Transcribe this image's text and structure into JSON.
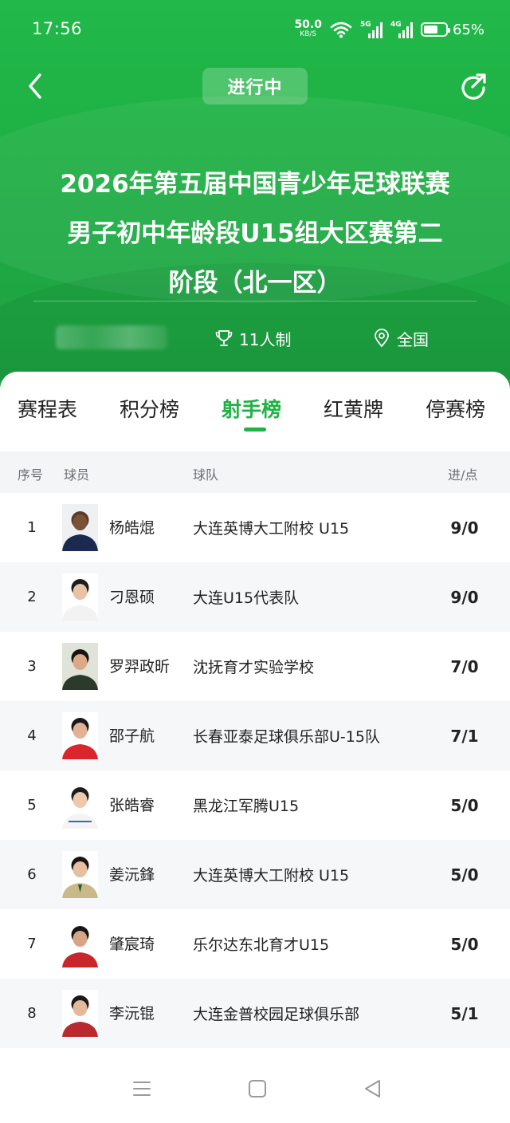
{
  "status_bar": {
    "time": "17:56",
    "net_speed_value": "50.0",
    "net_speed_unit": "KB/S",
    "sim1_label": "5G",
    "sim2_label": "4G",
    "battery_percent": "65%",
    "battery_level": 0.65
  },
  "header": {
    "status_label": "进行中",
    "title_line1": "2026年第五届中国青少年足球联赛",
    "title_line2": "男子初中年龄段U15组大区赛第二",
    "title_line3": "阶段（北一区）",
    "format_label": "11人制",
    "region_label": "全国",
    "accent_color": "#1fb245"
  },
  "tabs": [
    {
      "label": "赛程表"
    },
    {
      "label": "积分榜"
    },
    {
      "label": "射手榜"
    },
    {
      "label": "红黄牌"
    },
    {
      "label": "停赛榜"
    }
  ],
  "table": {
    "headers": {
      "rank": "序号",
      "player": "球员",
      "team": "球队",
      "goals": "进/点"
    },
    "rows": [
      {
        "rank": "1",
        "name": "杨皓焜",
        "team": "大连英博大工附校 U15",
        "goals": "9/0"
      },
      {
        "rank": "2",
        "name": "刁恩硕",
        "team": "大连U15代表队",
        "goals": "9/0"
      },
      {
        "rank": "3",
        "name": "罗羿政昕",
        "team": "沈抚育才实验学校",
        "goals": "7/0"
      },
      {
        "rank": "4",
        "name": "邵子航",
        "team": "长春亚泰足球俱乐部U-15队",
        "goals": "7/1"
      },
      {
        "rank": "5",
        "name": "张皓睿",
        "team": "黑龙江军腾U15",
        "goals": "5/0"
      },
      {
        "rank": "6",
        "name": "姜沅鋒",
        "team": "大连英博大工附校 U15",
        "goals": "5/0"
      },
      {
        "rank": "7",
        "name": "肇宸琦",
        "team": "乐尔达东北育才U15",
        "goals": "5/0"
      },
      {
        "rank": "8",
        "name": "李沅锟",
        "team": "大连金普校园足球俱乐部",
        "goals": "5/1"
      }
    ]
  },
  "nav_icons": [
    "menu-icon",
    "home-square-icon",
    "back-triangle-icon"
  ]
}
